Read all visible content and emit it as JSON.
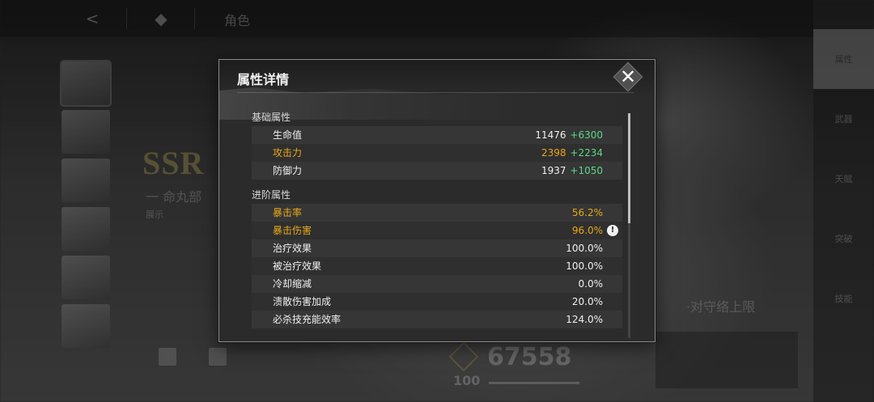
{
  "background": {
    "top_title": "角色",
    "ssr": "SSR",
    "char_name": "一 命丸部",
    "edit_label": "展示",
    "right_nav": [
      "属性",
      "武器",
      "天赋",
      "突破",
      "技能"
    ],
    "power_value": "67558",
    "level_value": "100",
    "skill_text": "·对守络上限"
  },
  "modal": {
    "title": "属性详情",
    "close_icon": "close-x-icon",
    "basic_section": {
      "title": "基础属性",
      "rows": [
        {
          "label": "生命值",
          "value": "11476",
          "bonus": "+6300",
          "highlight": false
        },
        {
          "label": "攻击力",
          "value": "2398",
          "bonus": "+2234",
          "highlight": true
        },
        {
          "label": "防御力",
          "value": "1937",
          "bonus": "+1050",
          "highlight": false
        }
      ]
    },
    "advanced_section": {
      "title": "进阶属性",
      "rows": [
        {
          "label": "暴击率",
          "value": "56.2%",
          "highlight": true
        },
        {
          "label": "暴击伤害",
          "value": "96.0%",
          "highlight": true,
          "info_icon": "!"
        },
        {
          "label": "治疗效果",
          "value": "100.0%",
          "highlight": false
        },
        {
          "label": "被治疗效果",
          "value": "100.0%",
          "highlight": false
        },
        {
          "label": "冷却缩减",
          "value": "0.0%",
          "highlight": false
        },
        {
          "label": "溃散伤害加成",
          "value": "20.0%",
          "highlight": false
        },
        {
          "label": "必杀技充能效率",
          "value": "124.0%",
          "highlight": false
        }
      ]
    },
    "scroll_position": 0.0
  },
  "colors": {
    "highlight": "#e8a818",
    "bonus": "#5bd88a",
    "panel_bg": "#2b2b2b"
  }
}
